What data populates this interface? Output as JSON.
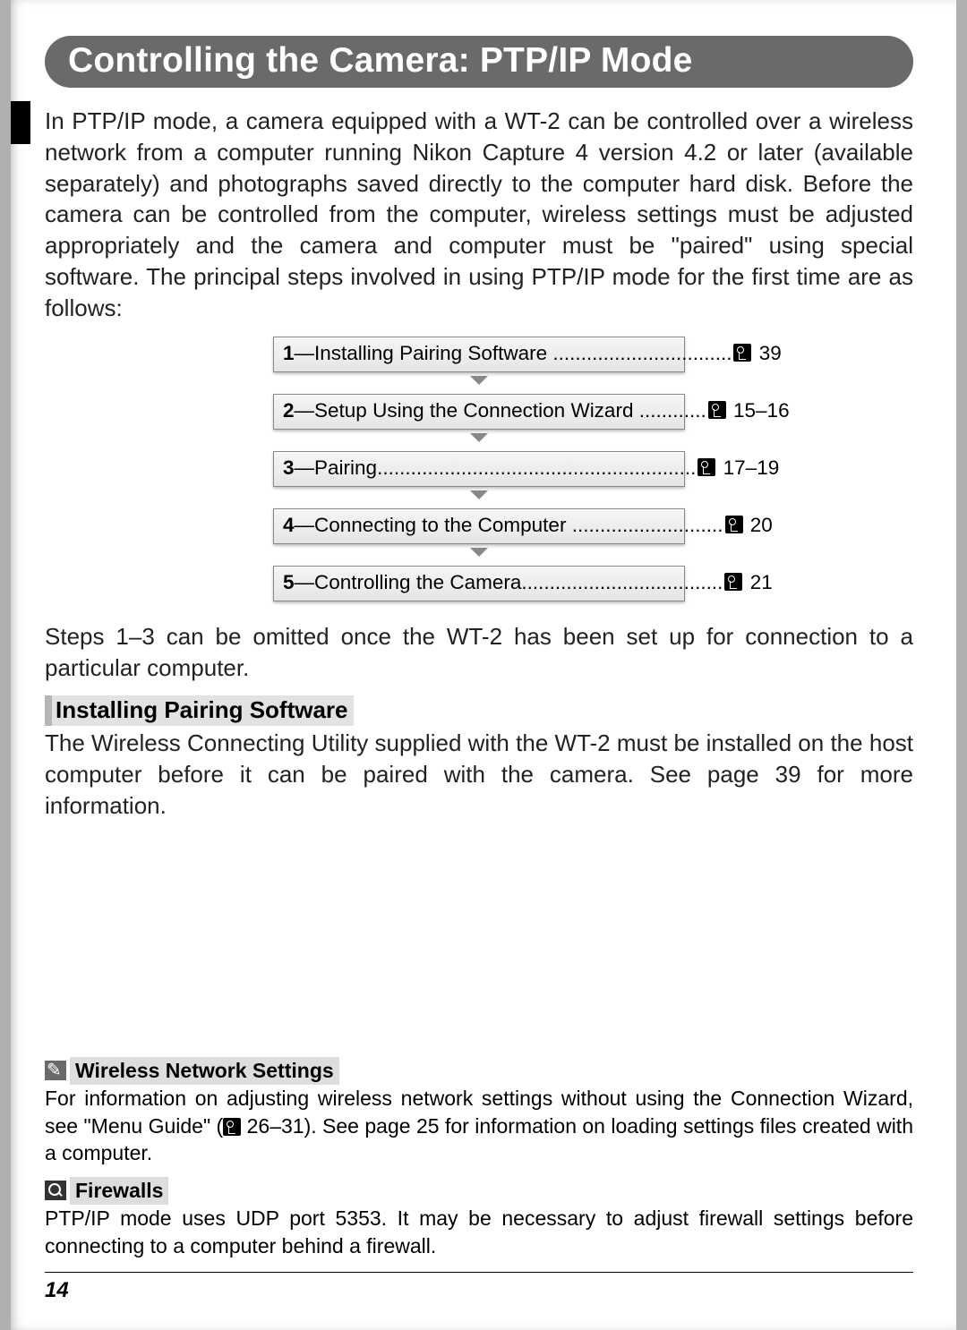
{
  "title": "Controlling the Camera: PTP/IP Mode",
  "intro": "In PTP/IP mode, a camera equipped with a WT-2 can be controlled over a wireless network from a computer running Nikon Capture 4 version 4.2 or later (available separately) and photographs saved directly to the computer hard disk.  Before the camera can be controlled from the computer, wireless settings must be adjusted appropriately and the camera and computer must be \"paired\" using special software.  The principal steps involved in using PTP/IP mode for the first time are as follows:",
  "steps": [
    {
      "num": "1",
      "label": "—Installing Pairing Software",
      "dots": "................................",
      "page": "39"
    },
    {
      "num": "2",
      "label": "—Setup Using the Connection Wizard",
      "dots": "............",
      "page": "15–16"
    },
    {
      "num": "3",
      "label": "—Pairing",
      "dots": ".........................................................",
      "page": "17–19"
    },
    {
      "num": "4",
      "label": "—Connecting to the Computer",
      "dots": "...........................",
      "page": "20"
    },
    {
      "num": "5",
      "label": "—Controlling the Camera",
      "dots": "....................................",
      "page": "21"
    }
  ],
  "after_steps": "Steps 1–3 can be omitted once the WT-2 has been set up for connection to a particular computer.",
  "subhead": "Installing Pairing Software",
  "subtext": "The Wireless Connecting Utility supplied with the WT-2 must be installed on the host computer before it can be paired with the camera.  See page 39 for more information.",
  "note1_title": "Wireless Network Settings",
  "note1_text_a": "For information on adjusting wireless network settings without using the Connection Wizard, see \"Menu Guide\" (",
  "note1_text_b": " 26–31).  See page 25 for information on loading settings files created with a computer.",
  "note2_title": "Firewalls",
  "note2_text": "PTP/IP mode uses UDP port 5353.  It may be necessary to adjust firewall settings before connecting to a computer behind a firewall.",
  "page_num": "14"
}
